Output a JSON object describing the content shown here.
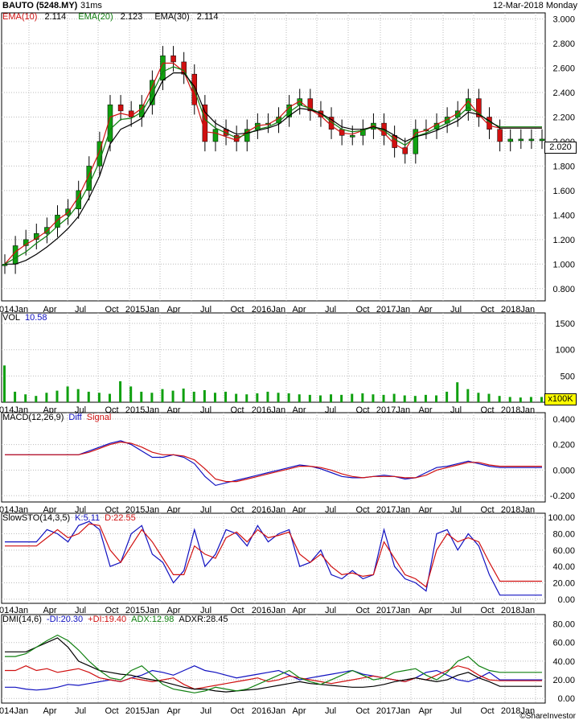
{
  "header": {
    "ticker": "BAUTO (5248.MY)",
    "interval": "31ms",
    "date": "12-Mar-2018 Monday"
  },
  "legends": {
    "price": [
      {
        "label": "EMA(10)",
        "value": "2.114",
        "color": "#d01010"
      },
      {
        "label": "EMA(20)",
        "value": "2.123",
        "color": "#108010"
      },
      {
        "label": "EMA(30)",
        "value": "2.114",
        "color": "#000000"
      }
    ],
    "volume": {
      "label": "VOL",
      "value": "10.58",
      "color": "#1010c0"
    },
    "macd": {
      "label": "MACD(12,26,9)",
      "diff": "Diff",
      "signal": "Signal",
      "diff_color": "#1010c0",
      "signal_color": "#d01010"
    },
    "sto": {
      "label": "SlowSTO(14,3,5)",
      "k": "K:5.11",
      "d": "D:22.55",
      "k_color": "#1010c0",
      "d_color": "#d01010"
    },
    "dmi": {
      "label": "DMI(14,6)",
      "minus": "-DI:20.30",
      "plus": "+DI:19.40",
      "adx": "ADX:12.98",
      "adxr": "ADXR:28.45"
    }
  },
  "last_price_badge": "2.020",
  "volume_unit_badge": "x100K",
  "footer": "©ShareInvestor",
  "chart_data": [
    {
      "type": "line",
      "panel": "price",
      "title": "",
      "x_labels": [
        "2014Jan",
        "Apr",
        "Jul",
        "Oct",
        "2015Jan",
        "Apr",
        "Jul",
        "Oct",
        "2016Jan",
        "Apr",
        "Jul",
        "Oct",
        "2017Jan",
        "Apr",
        "Jul",
        "Oct",
        "2018Jan"
      ],
      "x": [
        0,
        1,
        2,
        3,
        4,
        5,
        6,
        7,
        8,
        9,
        10,
        11,
        12,
        13,
        14,
        15,
        16,
        17,
        18,
        19,
        20,
        21,
        22,
        23,
        24,
        25,
        26,
        27,
        28,
        29,
        30,
        31,
        32,
        33,
        34,
        35,
        36,
        37,
        38,
        39,
        40,
        41,
        42,
        43,
        44,
        45,
        46,
        47,
        48,
        49,
        50,
        51
      ],
      "close": [
        1.0,
        1.15,
        1.2,
        1.25,
        1.3,
        1.4,
        1.45,
        1.6,
        1.8,
        2.0,
        2.3,
        2.25,
        2.2,
        2.3,
        2.5,
        2.7,
        2.65,
        2.55,
        2.3,
        2.0,
        2.1,
        2.05,
        2.0,
        2.1,
        2.15,
        2.15,
        2.2,
        2.3,
        2.35,
        2.25,
        2.2,
        2.1,
        2.05,
        2.05,
        2.1,
        2.15,
        2.05,
        1.95,
        1.9,
        2.1,
        2.1,
        2.15,
        2.2,
        2.25,
        2.35,
        2.2,
        2.1,
        2.0,
        2.02,
        2.02,
        2.02,
        2.02
      ],
      "series": [
        {
          "name": "EMA(10)",
          "color": "#d01010",
          "values": [
            1.0,
            1.1,
            1.16,
            1.21,
            1.27,
            1.36,
            1.42,
            1.55,
            1.73,
            1.92,
            2.2,
            2.23,
            2.21,
            2.27,
            2.45,
            2.64,
            2.64,
            2.57,
            2.36,
            2.08,
            2.07,
            2.04,
            2.01,
            2.08,
            2.13,
            2.14,
            2.19,
            2.28,
            2.33,
            2.26,
            2.21,
            2.13,
            2.07,
            2.06,
            2.09,
            2.13,
            2.07,
            1.98,
            1.93,
            2.07,
            2.09,
            2.14,
            2.18,
            2.23,
            2.33,
            2.22,
            2.13,
            2.11,
            2.11,
            2.11,
            2.11,
            2.11
          ]
        },
        {
          "name": "EMA(20)",
          "color": "#108010",
          "values": [
            1.0,
            1.05,
            1.1,
            1.17,
            1.23,
            1.31,
            1.38,
            1.49,
            1.65,
            1.84,
            2.1,
            2.18,
            2.19,
            2.24,
            2.39,
            2.57,
            2.61,
            2.58,
            2.42,
            2.18,
            2.11,
            2.07,
            2.03,
            2.06,
            2.1,
            2.12,
            2.16,
            2.24,
            2.3,
            2.27,
            2.23,
            2.16,
            2.1,
            2.08,
            2.09,
            2.12,
            2.09,
            2.02,
            1.97,
            2.04,
            2.07,
            2.11,
            2.15,
            2.2,
            2.28,
            2.23,
            2.16,
            2.12,
            2.12,
            2.12,
            2.12,
            2.12
          ]
        },
        {
          "name": "EMA(30)",
          "color": "#000000",
          "values": [
            1.0,
            1.0,
            1.03,
            1.08,
            1.14,
            1.21,
            1.29,
            1.39,
            1.54,
            1.72,
            1.98,
            2.1,
            2.14,
            2.19,
            2.33,
            2.5,
            2.56,
            2.56,
            2.45,
            2.24,
            2.15,
            2.1,
            2.06,
            2.07,
            2.09,
            2.11,
            2.14,
            2.21,
            2.27,
            2.26,
            2.23,
            2.18,
            2.12,
            2.1,
            2.1,
            2.12,
            2.1,
            2.05,
            2.0,
            2.04,
            2.06,
            2.09,
            2.13,
            2.17,
            2.24,
            2.22,
            2.17,
            2.11,
            2.11,
            2.11,
            2.11,
            2.11
          ]
        }
      ],
      "ylim": [
        0.7,
        3.05
      ],
      "y_ticks": [
        "0.800",
        "1.000",
        "1.200",
        "1.400",
        "1.600",
        "1.800",
        "2.000",
        "2.200",
        "2.400",
        "2.600",
        "2.800",
        "3.000"
      ],
      "grid": true
    },
    {
      "type": "bar",
      "panel": "volume",
      "title": "",
      "x_labels": [
        "2014Jan",
        "Apr",
        "Jul",
        "Oct",
        "2015Jan",
        "Apr",
        "Jul",
        "Oct",
        "2016Jan",
        "Apr",
        "Jul",
        "Oct",
        "2017Jan",
        "Apr",
        "Jul",
        "Oct",
        "2018Jan"
      ],
      "values": [
        700,
        200,
        150,
        120,
        180,
        220,
        300,
        250,
        200,
        180,
        160,
        400,
        300,
        200,
        180,
        250,
        220,
        260,
        200,
        230,
        180,
        200,
        160,
        150,
        170,
        200,
        180,
        170,
        150,
        140,
        130,
        150,
        140,
        160,
        170,
        150,
        140,
        160,
        130,
        120,
        140,
        130,
        200,
        380,
        250,
        180,
        160,
        120,
        100,
        90,
        100,
        100
      ],
      "ylim": [
        0,
        1700
      ],
      "y_ticks": [
        "500",
        "1000",
        "1500"
      ],
      "grid": true
    },
    {
      "type": "line",
      "panel": "macd",
      "title": "",
      "x_labels": [
        "2014Jan",
        "Apr",
        "Jul",
        "Oct",
        "2015Jan",
        "Apr",
        "Jul",
        "Oct",
        "2016Jan",
        "Apr",
        "Jul",
        "Oct",
        "2017Jan",
        "Apr",
        "Jul",
        "Oct",
        "2018Jan"
      ],
      "series": [
        {
          "name": "Diff",
          "color": "#1010c0",
          "values": [
            0.12,
            0.12,
            0.12,
            0.12,
            0.12,
            0.12,
            0.12,
            0.12,
            0.15,
            0.18,
            0.21,
            0.23,
            0.2,
            0.15,
            0.1,
            0.1,
            0.12,
            0.1,
            0.05,
            -0.05,
            -0.12,
            -0.1,
            -0.08,
            -0.06,
            -0.04,
            -0.02,
            0.0,
            0.02,
            0.04,
            0.03,
            0.01,
            -0.02,
            -0.05,
            -0.06,
            -0.06,
            -0.05,
            -0.04,
            -0.05,
            -0.07,
            -0.06,
            -0.02,
            0.02,
            0.03,
            0.05,
            0.07,
            0.05,
            0.03,
            0.02,
            0.02,
            0.02,
            0.02,
            0.02
          ]
        },
        {
          "name": "Signal",
          "color": "#d01010",
          "values": [
            0.12,
            0.12,
            0.12,
            0.12,
            0.12,
            0.12,
            0.12,
            0.12,
            0.14,
            0.17,
            0.2,
            0.22,
            0.21,
            0.18,
            0.14,
            0.12,
            0.12,
            0.11,
            0.08,
            0.01,
            -0.07,
            -0.09,
            -0.09,
            -0.07,
            -0.05,
            -0.03,
            -0.01,
            0.01,
            0.03,
            0.03,
            0.02,
            0.0,
            -0.03,
            -0.05,
            -0.06,
            -0.05,
            -0.05,
            -0.05,
            -0.06,
            -0.06,
            -0.04,
            0.0,
            0.02,
            0.04,
            0.06,
            0.06,
            0.04,
            0.03,
            0.03,
            0.03,
            0.03,
            0.03
          ]
        }
      ],
      "ylim": [
        -0.25,
        0.45
      ],
      "y_ticks": [
        "-0.200",
        "0.000",
        "0.200",
        "0.400"
      ],
      "grid": true
    },
    {
      "type": "line",
      "panel": "sto",
      "title": "",
      "x_labels": [
        "2014Jan",
        "Apr",
        "Jul",
        "Oct",
        "2015Jan",
        "Apr",
        "Jul",
        "Oct",
        "2016Jan",
        "Apr",
        "Jul",
        "Oct",
        "2017Jan",
        "Apr",
        "Jul",
        "Oct",
        "2018Jan"
      ],
      "series": [
        {
          "name": "K",
          "color": "#1010c0",
          "values": [
            70,
            70,
            70,
            70,
            85,
            80,
            70,
            90,
            95,
            85,
            40,
            45,
            80,
            90,
            55,
            45,
            20,
            35,
            85,
            40,
            55,
            85,
            80,
            65,
            90,
            70,
            80,
            85,
            40,
            45,
            60,
            30,
            25,
            35,
            25,
            30,
            85,
            40,
            25,
            20,
            10,
            80,
            85,
            60,
            80,
            65,
            30,
            5,
            5,
            5,
            5,
            5
          ]
        },
        {
          "name": "D",
          "color": "#d01010",
          "values": [
            65,
            65,
            65,
            65,
            75,
            85,
            75,
            80,
            92,
            90,
            60,
            45,
            65,
            85,
            70,
            50,
            30,
            30,
            65,
            55,
            50,
            75,
            82,
            70,
            85,
            75,
            78,
            82,
            55,
            45,
            55,
            40,
            30,
            32,
            28,
            30,
            70,
            50,
            30,
            25,
            15,
            60,
            80,
            70,
            75,
            70,
            45,
            22,
            22,
            22,
            22,
            22
          ]
        }
      ],
      "ylim": [
        -5,
        105
      ],
      "y_ticks": [
        "0.00",
        "20.00",
        "40.00",
        "60.00",
        "80.00",
        "100.00"
      ],
      "grid": true
    },
    {
      "type": "line",
      "panel": "dmi",
      "title": "",
      "x_labels": [
        "2014Jan",
        "Apr",
        "Jul",
        "Oct",
        "2015Jan",
        "Apr",
        "Jul",
        "Oct",
        "2016Jan",
        "Apr",
        "Jul",
        "Oct",
        "2017Jan",
        "Apr",
        "Jul",
        "Oct",
        "2018Jan"
      ],
      "series": [
        {
          "name": "-DI",
          "color": "#1010c0",
          "values": [
            12,
            12,
            10,
            9,
            10,
            12,
            15,
            14,
            16,
            18,
            20,
            18,
            22,
            25,
            30,
            28,
            25,
            30,
            35,
            30,
            28,
            25,
            22,
            24,
            26,
            28,
            30,
            25,
            20,
            22,
            24,
            26,
            28,
            30,
            26,
            24,
            22,
            20,
            18,
            22,
            28,
            30,
            25,
            20,
            18,
            22,
            28,
            20,
            20,
            20,
            20,
            20
          ]
        },
        {
          "name": "+DI",
          "color": "#d01010",
          "values": [
            30,
            30,
            35,
            30,
            32,
            28,
            30,
            32,
            28,
            22,
            20,
            18,
            22,
            20,
            18,
            20,
            22,
            15,
            10,
            12,
            14,
            16,
            18,
            20,
            22,
            18,
            20,
            24,
            22,
            20,
            18,
            16,
            18,
            20,
            22,
            24,
            22,
            20,
            18,
            22,
            20,
            25,
            30,
            35,
            32,
            25,
            20,
            19,
            19,
            19,
            19,
            19
          ]
        },
        {
          "name": "ADX",
          "color": "#000000",
          "values": [
            50,
            50,
            50,
            55,
            60,
            65,
            55,
            40,
            35,
            30,
            28,
            26,
            25,
            22,
            20,
            18,
            15,
            12,
            10,
            10,
            8,
            7,
            8,
            9,
            10,
            12,
            14,
            16,
            18,
            16,
            15,
            14,
            13,
            12,
            12,
            13,
            15,
            18,
            20,
            22,
            20,
            18,
            20,
            25,
            28,
            22,
            18,
            13,
            13,
            13,
            13,
            13
          ]
        },
        {
          "name": "ADXR",
          "color": "#108010",
          "values": [
            45,
            45,
            48,
            55,
            62,
            68,
            62,
            52,
            40,
            30,
            22,
            20,
            30,
            35,
            25,
            15,
            10,
            8,
            6,
            8,
            12,
            10,
            8,
            10,
            15,
            20,
            25,
            30,
            22,
            18,
            15,
            20,
            25,
            30,
            25,
            20,
            22,
            28,
            30,
            32,
            25,
            20,
            28,
            40,
            45,
            35,
            30,
            28,
            28,
            28,
            28,
            28
          ]
        }
      ],
      "ylim": [
        -5,
        90
      ],
      "y_ticks": [
        "0.00",
        "20.00",
        "40.00",
        "60.00",
        "80.00"
      ],
      "grid": true
    }
  ]
}
